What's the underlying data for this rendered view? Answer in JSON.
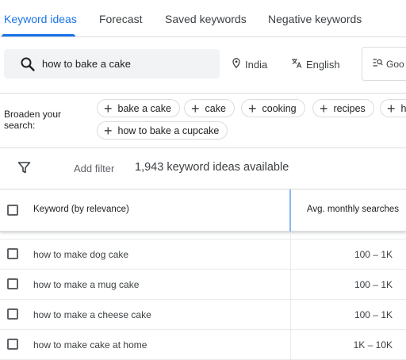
{
  "tabs": [
    {
      "label": "Keyword ideas",
      "active": true
    },
    {
      "label": "Forecast",
      "active": false
    },
    {
      "label": "Saved keywords",
      "active": false
    },
    {
      "label": "Negative keywords",
      "active": false
    }
  ],
  "search": {
    "value": "how to bake a cake",
    "icon": "search-icon"
  },
  "location": {
    "label": "India",
    "icon": "location-pin-icon"
  },
  "language": {
    "label": "English",
    "icon": "translate-icon"
  },
  "source_button": {
    "label": "Goo",
    "icon": "site-search-icon"
  },
  "broaden": {
    "label": "Broaden your search:",
    "chips": [
      "bake a cake",
      "cake",
      "cooking",
      "recipes",
      "h",
      "how to bake a cupcake"
    ]
  },
  "filter": {
    "add_filter": "Add filter",
    "count_text": "1,943 keyword ideas available",
    "icon": "filter-icon"
  },
  "table": {
    "columns": {
      "keyword": "Keyword (by relevance)",
      "avg": "Avg. monthly searches"
    },
    "rows": [
      {
        "keyword": "how to make dog cake",
        "avg": "100 – 1K"
      },
      {
        "keyword": "how to make a mug cake",
        "avg": "100 – 1K"
      },
      {
        "keyword": "how to make a cheese cake",
        "avg": "100 – 1K"
      },
      {
        "keyword": "how to make cake at home",
        "avg": "1K – 10K"
      }
    ]
  },
  "colors": {
    "accent": "#1a73e8",
    "divider": "#dadce0",
    "search_bg": "#f1f3f4"
  }
}
